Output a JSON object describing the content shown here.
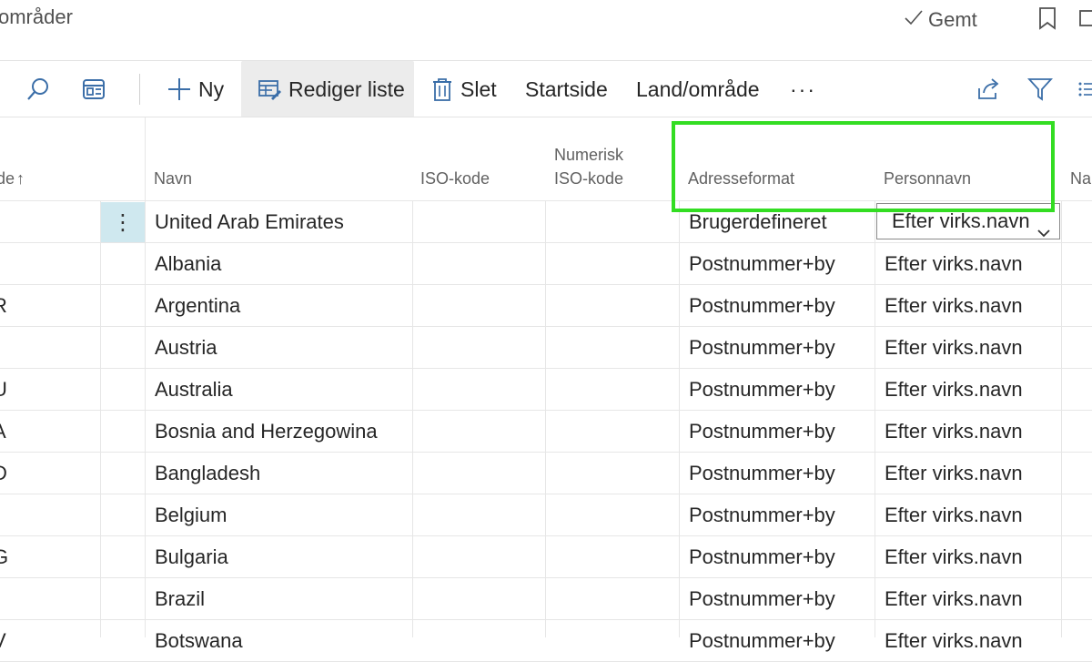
{
  "header": {
    "title": "områder",
    "saved_label": "Gemt"
  },
  "toolbar": {
    "new_label": "Ny",
    "edit_list_label": "Rediger liste",
    "delete_label": "Slet",
    "home_label": "Startside",
    "country_label": "Land/område",
    "more_label": "···"
  },
  "columns": {
    "code": "de",
    "code_sort_glyph": "↑",
    "name": "Navn",
    "iso": "ISO-kode",
    "numeric_iso_line1": "Numerisk",
    "numeric_iso_line2": "ISO-kode",
    "address_format": "Adresseformat",
    "person_name": "Personnavn",
    "next": "Na"
  },
  "row_action_glyph": "⋮",
  "rows": [
    {
      "code": "",
      "name": "United Arab Emirates",
      "address_format": "Brugerdefineret",
      "person_name": "Efter virks.navn"
    },
    {
      "code": "",
      "name": "Albania",
      "address_format": "Postnummer+by",
      "person_name": "Efter virks.navn"
    },
    {
      "code": "R",
      "name": "Argentina",
      "address_format": "Postnummer+by",
      "person_name": "Efter virks.navn"
    },
    {
      "code": "",
      "name": "Austria",
      "address_format": "Postnummer+by",
      "person_name": "Efter virks.navn"
    },
    {
      "code": "U",
      "name": "Australia",
      "address_format": "Postnummer+by",
      "person_name": "Efter virks.navn"
    },
    {
      "code": "A",
      "name": "Bosnia and Herzegowina",
      "address_format": "Postnummer+by",
      "person_name": "Efter virks.navn"
    },
    {
      "code": "D",
      "name": "Bangladesh",
      "address_format": "Postnummer+by",
      "person_name": "Efter virks.navn"
    },
    {
      "code": "",
      "name": "Belgium",
      "address_format": "Postnummer+by",
      "person_name": "Efter virks.navn"
    },
    {
      "code": "G",
      "name": "Bulgaria",
      "address_format": "Postnummer+by",
      "person_name": "Efter virks.navn"
    },
    {
      "code": "",
      "name": "Brazil",
      "address_format": "Postnummer+by",
      "person_name": "Efter virks.navn"
    },
    {
      "code": "V",
      "name": "Botswana",
      "address_format": "Postnummer+by",
      "person_name": "Efter virks.navn"
    }
  ],
  "colors": {
    "highlight": "#33dd22",
    "row_selected": "#cfe8ef",
    "toolbar_active": "#ececec"
  },
  "icons": [
    "checkmark-icon",
    "bookmark-icon",
    "collapse-icon",
    "search-icon",
    "view-layout-icon",
    "plus-icon",
    "edit-list-icon",
    "trash-icon",
    "share-icon",
    "filter-icon",
    "list-view-icon",
    "chevron-down-icon"
  ]
}
